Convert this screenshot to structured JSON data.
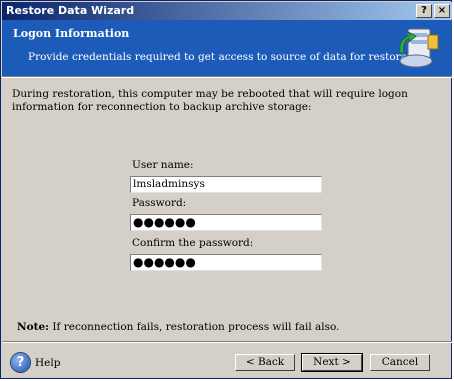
{
  "window": {
    "title": "Restore Data Wizard",
    "help_button": "?",
    "close_button": "×"
  },
  "header": {
    "title": "Logon Information",
    "subtitle": "Provide credentials required to get access to source of data for restoration."
  },
  "body": {
    "description": "During restoration, this computer may be rebooted that will require logon information for reconnection to backup archive storage:"
  },
  "form": {
    "username_label": "User name:",
    "username_value": "lmsladminsys",
    "password_label": "Password:",
    "password_value": "●●●●●●",
    "confirm_label": "Confirm the password:",
    "confirm_value": "●●●●●●"
  },
  "note": {
    "bold": "Note:",
    "text": " If reconnection fails, restoration process will fail also."
  },
  "footer": {
    "help_label": "Help",
    "back_label": "< Back",
    "next_label": "Next >",
    "cancel_label": "Cancel"
  }
}
